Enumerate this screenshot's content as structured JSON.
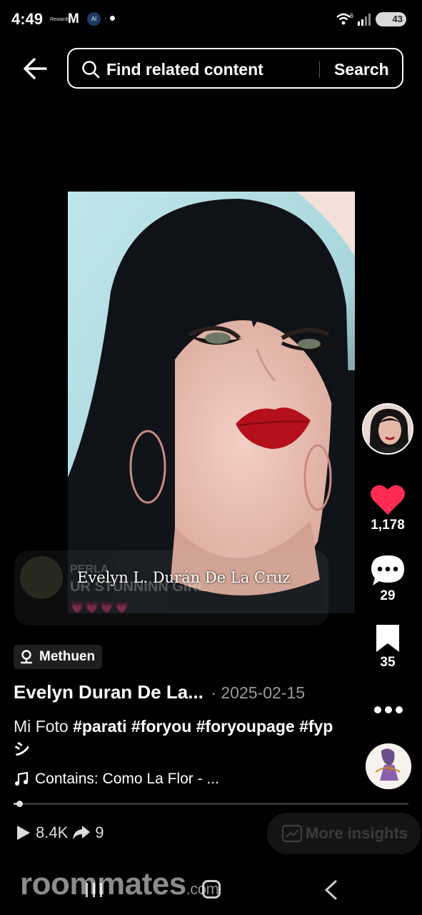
{
  "status_bar": {
    "time": "4:49",
    "rewards_label": "Rewards",
    "ai_label": "AI",
    "network_label": "6",
    "battery": "43"
  },
  "search": {
    "placeholder": "Find related content",
    "button_label": "Search"
  },
  "media": {
    "caption": "Evelyn L. Durán De La Cruz"
  },
  "comment_popup": {
    "line1": "PERLA",
    "line2": "UR STUNNINN GIRL",
    "hearts": "💗💗💗💗"
  },
  "rail": {
    "likes": "1,178",
    "comments": "29",
    "saves": "35",
    "like_color": "#fe2c55"
  },
  "post": {
    "location": "Methuen",
    "author": "Evelyn Duran De La...",
    "date": "· 2025-02-15",
    "description_prefix": "Mi Foto ",
    "hashtags": [
      "#parati",
      "#foryou",
      "#foryoupage",
      "#fypシ"
    ],
    "sound": "Contains: Como La Flor - ...",
    "progress": 0.015
  },
  "stats": {
    "plays": "8.4K",
    "shares": "9",
    "insights_label": "More insights"
  },
  "watermark": {
    "brand": "roommates",
    "suffix": ".com"
  }
}
